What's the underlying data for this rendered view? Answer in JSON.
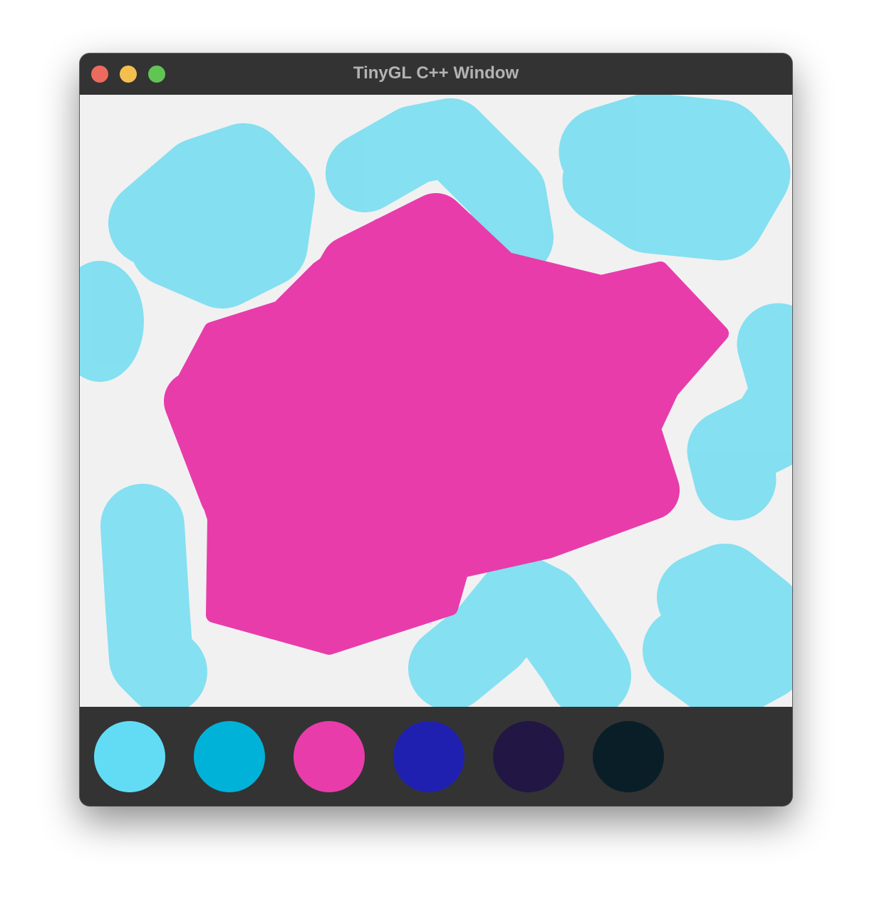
{
  "window": {
    "title": "TinyGL C++ Window",
    "controls": [
      "close",
      "minimize",
      "zoom"
    ]
  },
  "canvas": {
    "background": "#f1f1f2",
    "stroke_colors": {
      "light_cyan": "#6ddcf0",
      "magenta": "#e83cab"
    }
  },
  "palette": {
    "swatches": [
      {
        "name": "light-cyan",
        "color": "#62dcf4"
      },
      {
        "name": "cyan",
        "color": "#00b2d8"
      },
      {
        "name": "magenta",
        "color": "#e83cab"
      },
      {
        "name": "royal-blue",
        "color": "#2020b0"
      },
      {
        "name": "dark-purple",
        "color": "#221644"
      },
      {
        "name": "near-black-navy",
        "color": "#0a1e28"
      }
    ]
  }
}
